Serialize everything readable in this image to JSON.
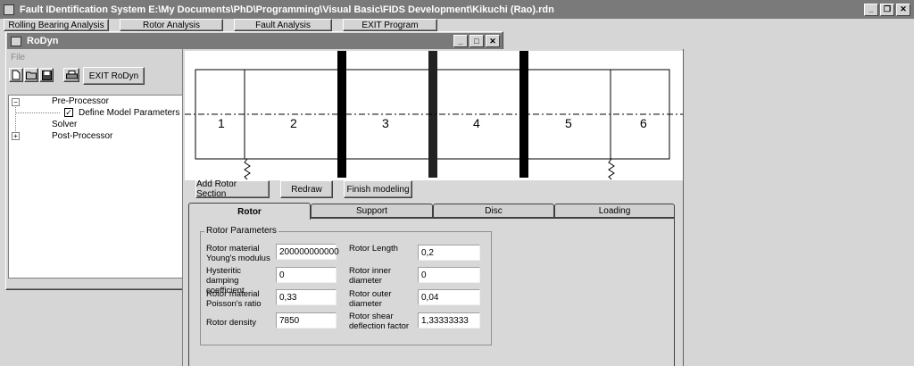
{
  "main_window": {
    "title": "Fault IDentification System   E:\\My Documents\\PhD\\Programming\\Visual Basic\\FIDS Development\\Kikuchi (Rao).rdn",
    "top_buttons": [
      "Rolling Bearing Analysis",
      "Rotor Analysis",
      "Fault Analysis",
      "EXIT Program"
    ]
  },
  "rodyn": {
    "title": "RoDyn",
    "menu_file": "File",
    "exit_button": "EXIT RoDyn",
    "tree": {
      "pre_processor": "Pre-Processor",
      "define_model": "Define Model Parameters",
      "solver": "Solver",
      "post_processor": "Post-Processor"
    }
  },
  "canvas": {
    "segments": [
      "1",
      "2",
      "3",
      "4",
      "5",
      "6"
    ]
  },
  "actions": {
    "add_rotor_section": "Add Rotor Section",
    "redraw": "Redraw",
    "finish_modeling": "Finish modeling"
  },
  "tabs": [
    "Rotor",
    "Support",
    "Disc",
    "Loading"
  ],
  "rotor_params": {
    "group_title": "Rotor Parameters",
    "youngs_label": "Rotor material Young's modulus",
    "youngs_value": "200000000000",
    "damping_label": "Hysteritic damping coefficient",
    "damping_value": "0",
    "poisson_label": "Rotor material Poisson's ratio",
    "poisson_value": "0,33",
    "density_label": "Rotor density",
    "density_value": "7850",
    "length_label": "Rotor Length",
    "length_value": "0,2",
    "inner_label": "Rotor inner diameter",
    "inner_value": "0",
    "outer_label": "Rotor outer diameter",
    "outer_value": "0,04",
    "shear_label": "Rotor shear deflection factor",
    "shear_value": "1,33333333"
  }
}
